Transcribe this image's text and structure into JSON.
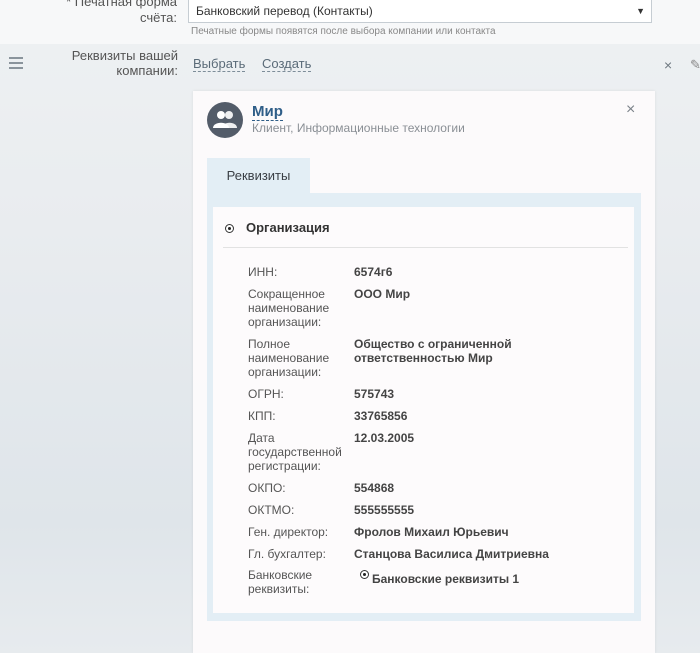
{
  "print_form": {
    "label_line1": "* Печатная форма",
    "label_line2": "счёта:",
    "value": "Банковский перевод (Контакты)",
    "hint": "Печатные формы появятся после выбора компании или контакта"
  },
  "requisites_row": {
    "label_line1": "Реквизиты вашей",
    "label_line2": "компании:",
    "select_link": "Выбрать",
    "create_link": "Создать",
    "close": "×",
    "edit": "✎"
  },
  "card": {
    "company_name": "Мир",
    "company_sub": "Клиент, Информационные технологии",
    "close": "×",
    "tab_label": "Реквизиты",
    "section_title": "Организация",
    "fields": [
      {
        "label": "ИНН:",
        "value": "6574г6"
      },
      {
        "label": "Сокращенное наименование организации:",
        "value": "ООО Мир"
      },
      {
        "label": "Полное наименование организации:",
        "value": "Общество с ограниченной ответственностью Мир"
      },
      {
        "label": "ОГРН:",
        "value": "575743"
      },
      {
        "label": "КПП:",
        "value": "33765856"
      },
      {
        "label": "Дата государственной регистрации:",
        "value": "12.03.2005"
      },
      {
        "label": "ОКПО:",
        "value": "554868"
      },
      {
        "label": "ОКТМО:",
        "value": "555555555"
      },
      {
        "label": "Ген. директор:",
        "value": "Фролов Михаил Юрьевич"
      },
      {
        "label": "Гл. бухгалтер:",
        "value": "Станцова Василиса Дмитриевна"
      },
      {
        "label": "Банковские реквизиты:",
        "value": "Банковские реквизиты 1"
      }
    ]
  }
}
